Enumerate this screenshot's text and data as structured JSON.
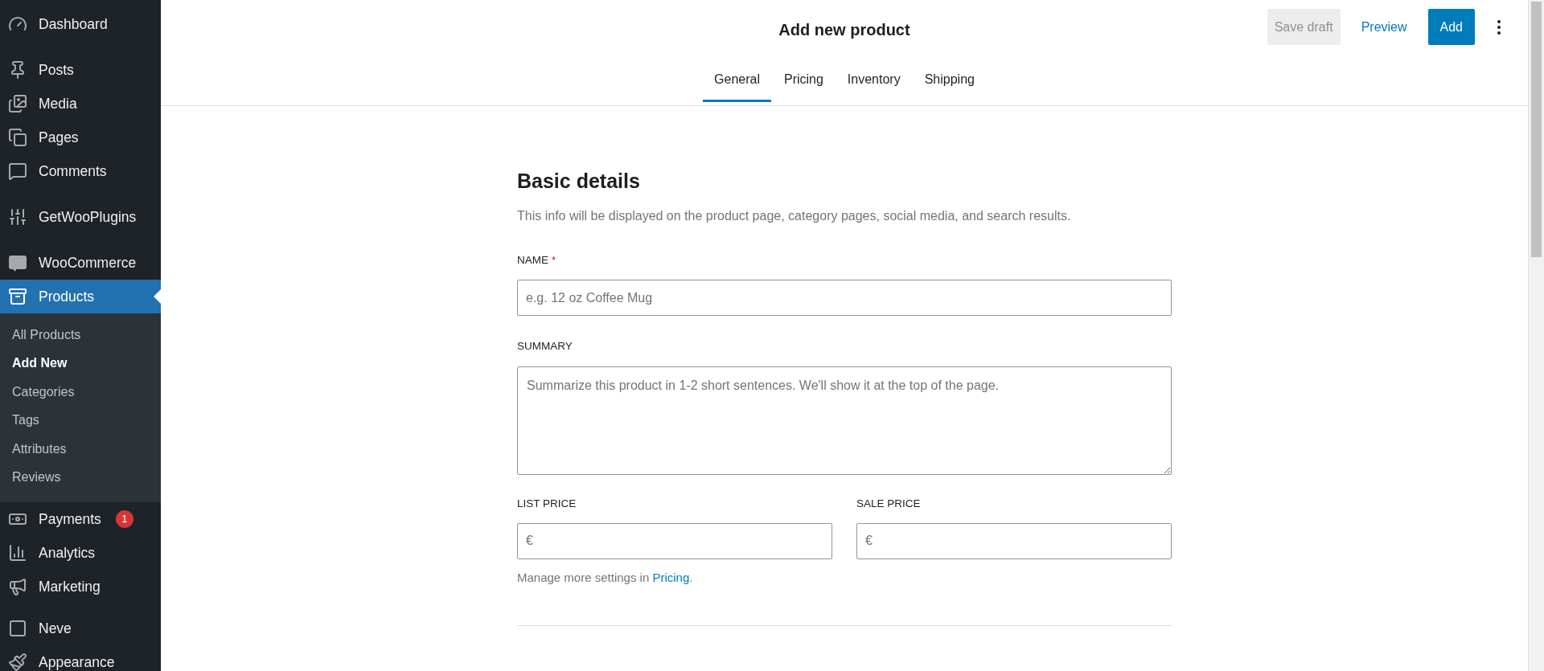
{
  "sidebar": {
    "items": [
      {
        "label": "Dashboard",
        "selected": false
      },
      {
        "label": "Posts",
        "selected": false
      },
      {
        "label": "Media",
        "selected": false
      },
      {
        "label": "Pages",
        "selected": false
      },
      {
        "label": "Comments",
        "selected": false
      },
      {
        "label": "GetWooPlugins",
        "selected": false
      },
      {
        "label": "WooCommerce",
        "selected": false
      },
      {
        "label": "Products",
        "selected": true,
        "children": [
          {
            "label": "All Products",
            "selected": false
          },
          {
            "label": "Add New",
            "selected": true
          },
          {
            "label": "Categories",
            "selected": false
          },
          {
            "label": "Tags",
            "selected": false
          },
          {
            "label": "Attributes",
            "selected": false
          },
          {
            "label": "Reviews",
            "selected": false
          }
        ]
      },
      {
        "label": "Payments",
        "selected": false,
        "badge": "1"
      },
      {
        "label": "Analytics",
        "selected": false
      },
      {
        "label": "Marketing",
        "selected": false
      },
      {
        "label": "Neve",
        "selected": false
      },
      {
        "label": "Appearance",
        "selected": false
      }
    ]
  },
  "header": {
    "title": "Add new product",
    "tabs": [
      {
        "label": "General",
        "selected": true
      },
      {
        "label": "Pricing",
        "selected": false
      },
      {
        "label": "Inventory",
        "selected": false
      },
      {
        "label": "Shipping",
        "selected": false
      }
    ],
    "buttons": [
      {
        "kind": "secondary",
        "label": "Save draft",
        "disabled": true
      },
      {
        "kind": "link",
        "label": "Preview",
        "disabled": false
      },
      {
        "kind": "primary",
        "label": "Add",
        "disabled": false
      }
    ]
  },
  "section": {
    "title": "Basic details",
    "description": "This info will be displayed on the product page, category pages, social media, and search results.",
    "name_field": {
      "label": "NAME",
      "required_mark": "*",
      "placeholder": "e.g. 12 oz Coffee Mug"
    },
    "summary_field": {
      "label": "SUMMARY",
      "placeholder": "Summarize this product in 1-2 short sentences. We'll show it at the top of the page."
    },
    "price_fields": [
      {
        "label": "LIST PRICE",
        "prefix": "€"
      },
      {
        "label": "SALE PRICE",
        "prefix": "€"
      }
    ],
    "help": {
      "text": "Manage more settings in",
      "link": "Pricing",
      "suffix": "."
    }
  }
}
